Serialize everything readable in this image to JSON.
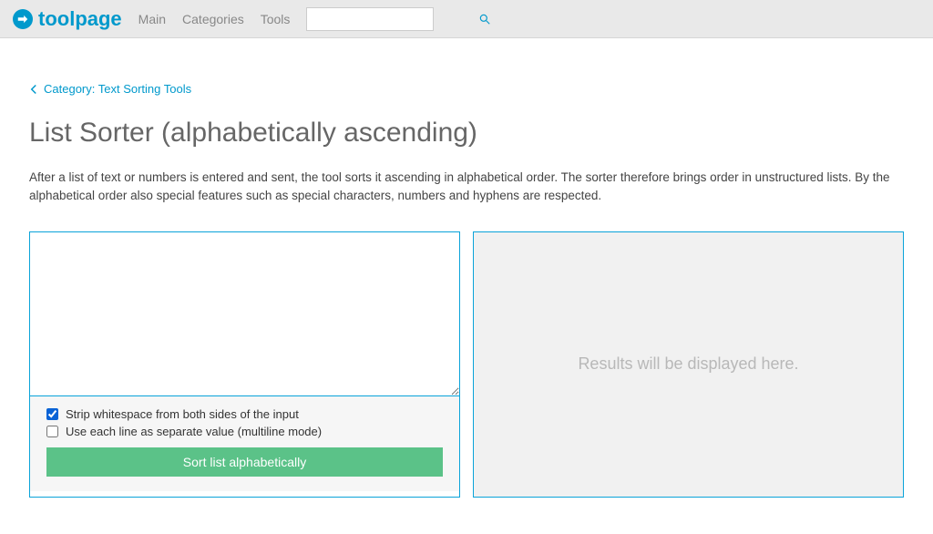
{
  "brand": {
    "name": "toolpage"
  },
  "nav": {
    "items": [
      "Main",
      "Categories",
      "Tools"
    ]
  },
  "search": {
    "placeholder": "",
    "value": ""
  },
  "breadcrumb": {
    "label": "Category: Text Sorting Tools"
  },
  "page": {
    "title": "List Sorter (alphabetically ascending)",
    "description": "After a list of text or numbers is entered and sent, the tool sorts it ascending in alphabetical order. The sorter therefore brings order in unstructured lists. By the alphabetical order also special features such as special characters, numbers and hyphens are respected."
  },
  "input": {
    "textarea_value": ""
  },
  "options": {
    "strip_whitespace": {
      "label": "Strip whitespace from both sides of the input",
      "checked": true
    },
    "multiline": {
      "label": "Use each line as separate value (multiline mode)",
      "checked": false
    }
  },
  "actions": {
    "submit_label": "Sort list alphabetically"
  },
  "output": {
    "placeholder": "Results will be displayed here."
  }
}
